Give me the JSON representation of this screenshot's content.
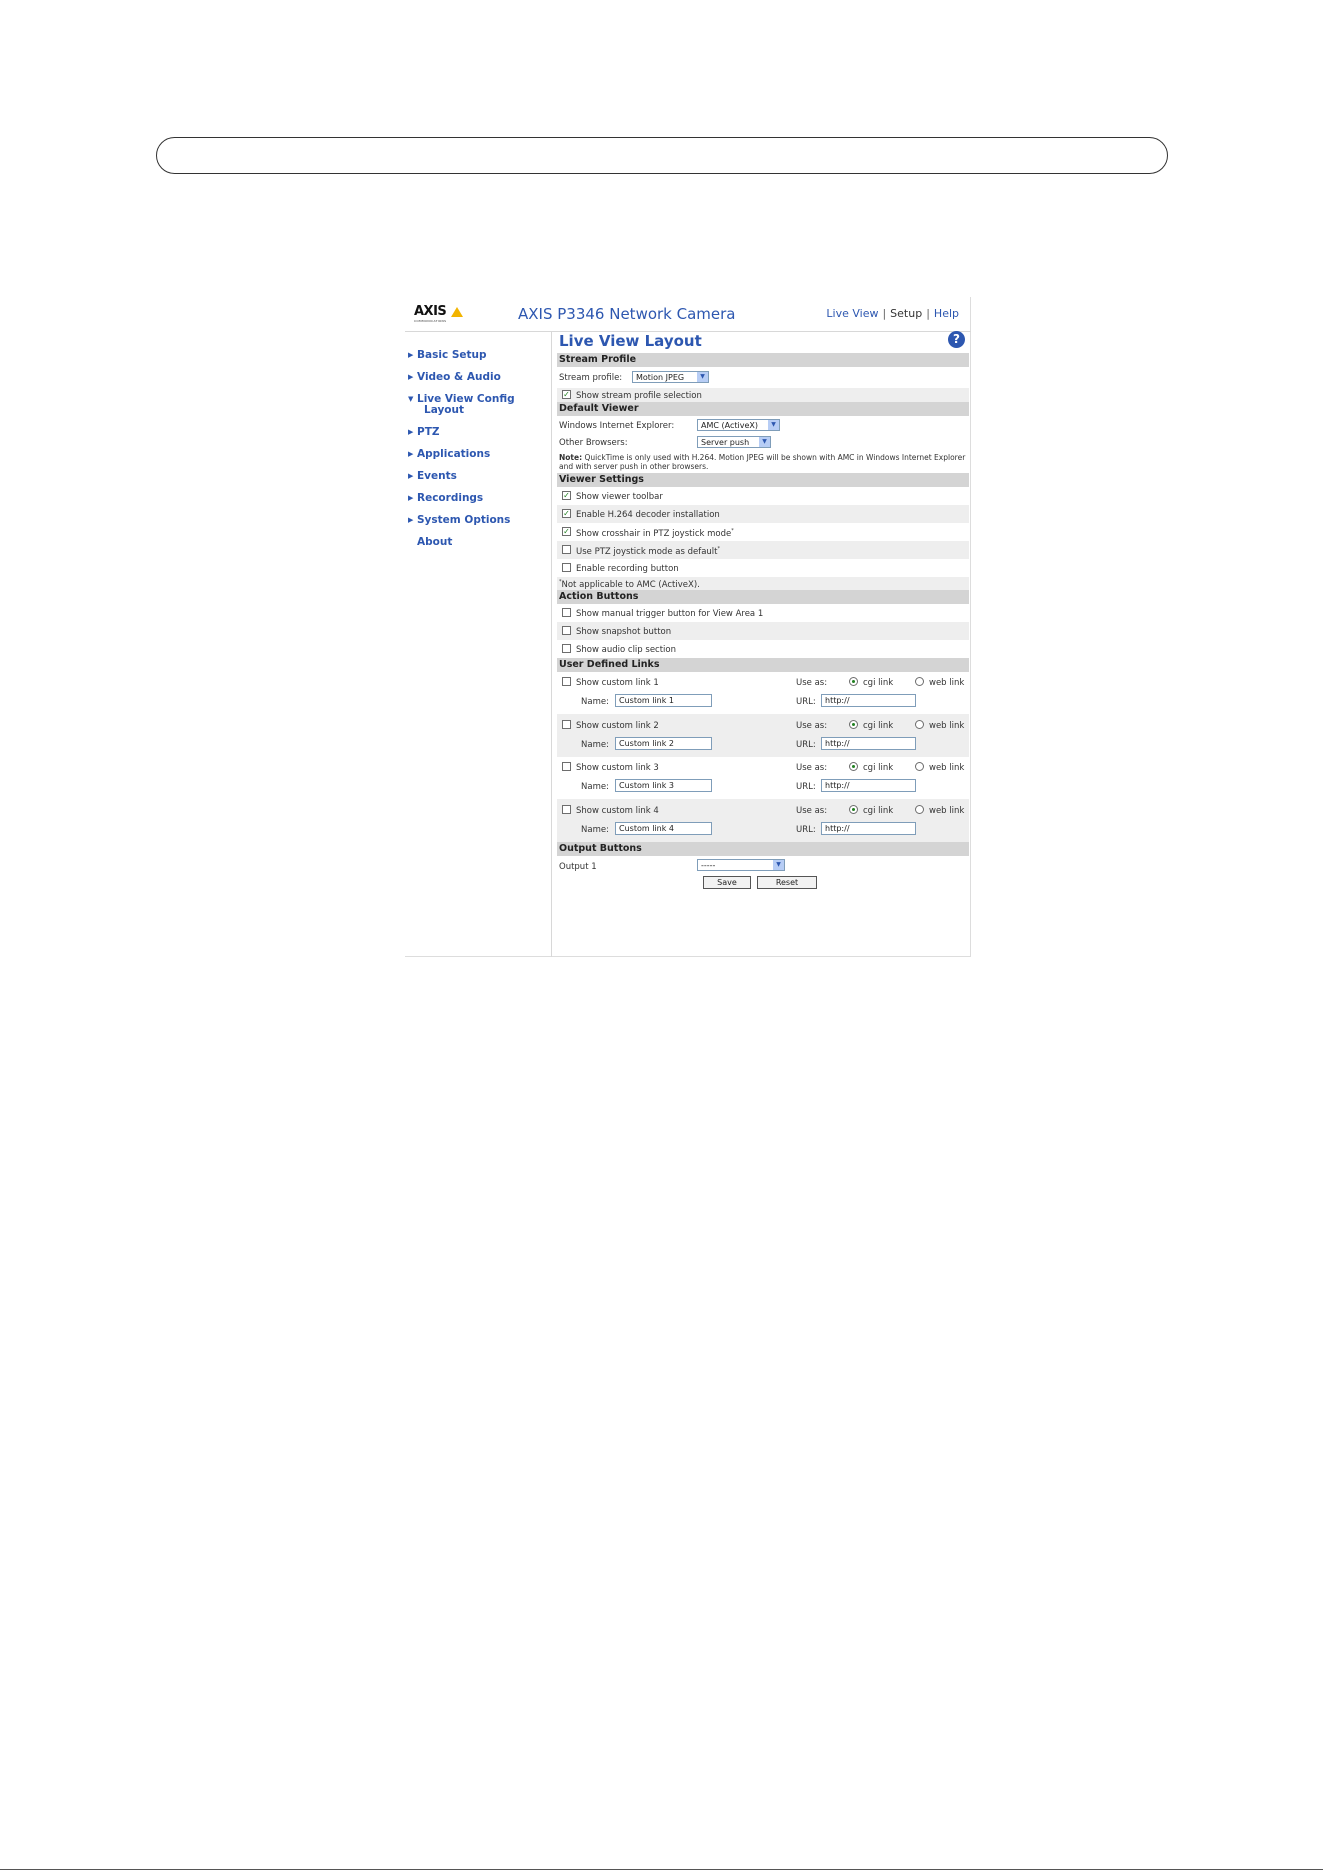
{
  "header": {
    "logo_text": "AXIS",
    "logo_subtext": "COMMUNICATIONS",
    "product_title": "AXIS P3346 Network Camera",
    "links": {
      "live_view": "Live View",
      "setup": "Setup",
      "help": "Help",
      "sep": "|"
    }
  },
  "sidebar": {
    "items": [
      "Basic Setup",
      "Video & Audio",
      "Live View Config",
      "PTZ",
      "Applications",
      "Events",
      "Recordings",
      "System Options",
      "About"
    ],
    "sub_item": "Layout"
  },
  "page_title": "Live View Layout",
  "help_icon": "?",
  "stream_profile": {
    "heading": "Stream Profile",
    "label": "Stream profile:",
    "value": "Motion JPEG",
    "show_selection": "Show stream profile selection",
    "show_selection_checked": true
  },
  "default_viewer": {
    "heading": "Default Viewer",
    "ie_label": "Windows Internet Explorer:",
    "ie_value": "AMC (ActiveX)",
    "other_label": "Other Browsers:",
    "other_value": "Server push",
    "note_bold": "Note:",
    "note_text": " QuickTime is only used with H.264. Motion JPEG will be shown with AMC in Windows Internet Explorer and with server push in other browsers."
  },
  "viewer_settings": {
    "heading": "Viewer Settings",
    "items": [
      {
        "label": "Show viewer toolbar",
        "checked": true,
        "star": false
      },
      {
        "label": "Enable H.264 decoder installation",
        "checked": true,
        "star": false
      },
      {
        "label": "Show crosshair in PTZ joystick mode",
        "checked": true,
        "star": true
      },
      {
        "label": "Use PTZ joystick mode as default",
        "checked": false,
        "star": true
      },
      {
        "label": "Enable recording button",
        "checked": false,
        "star": false
      }
    ],
    "footnote": "Not applicable to AMC (ActiveX).",
    "star": "*"
  },
  "action_buttons": {
    "heading": "Action Buttons",
    "items": [
      {
        "label": "Show manual trigger button for View Area 1",
        "checked": false
      },
      {
        "label": "Show snapshot button",
        "checked": false
      },
      {
        "label": "Show audio clip section",
        "checked": false
      }
    ]
  },
  "user_links": {
    "heading": "User Defined Links",
    "use_as": "Use as:",
    "cgi": "cgi link",
    "web": "web link",
    "name_label": "Name:",
    "url_label": "URL:",
    "links": [
      {
        "label": "Show custom link 1",
        "name": "Custom link 1",
        "url": "http://"
      },
      {
        "label": "Show custom link 2",
        "name": "Custom link 2",
        "url": "http://"
      },
      {
        "label": "Show custom link 3",
        "name": "Custom link 3",
        "url": "http://"
      },
      {
        "label": "Show custom link 4",
        "name": "Custom link 4",
        "url": "http://"
      }
    ]
  },
  "output_buttons": {
    "heading": "Output Buttons",
    "label": "Output 1",
    "value": "-----"
  },
  "buttons": {
    "save": "Save",
    "reset": "Reset"
  }
}
